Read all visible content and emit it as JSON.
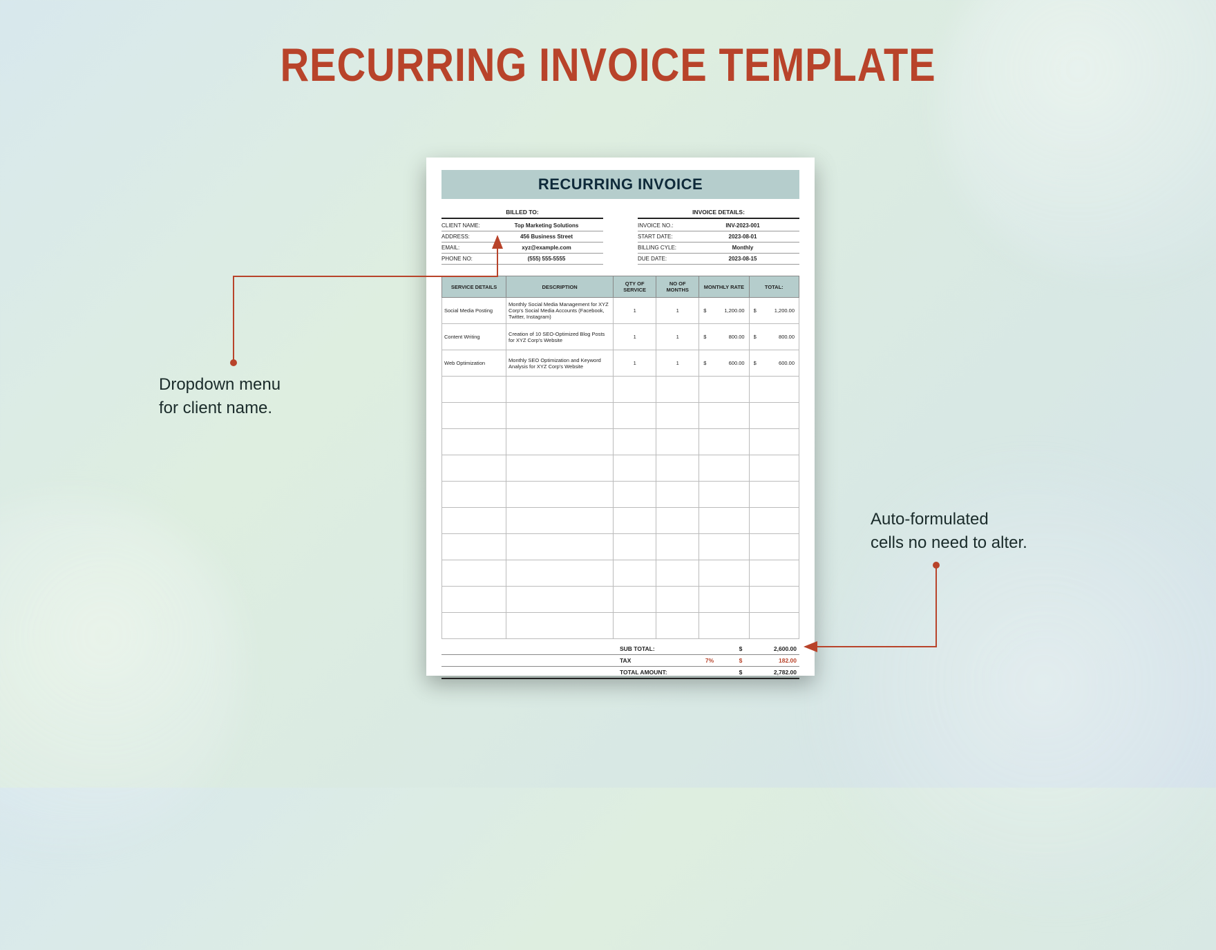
{
  "page_title": "RECURRING INVOICE TEMPLATE",
  "invoice": {
    "header": "RECURRING INVOICE",
    "billed_to_heading": "BILLED TO:",
    "invoice_details_heading": "INVOICE DETAILS:",
    "billed_to": {
      "client_label": "CLIENT NAME:",
      "client_value": "Top Marketing Solutions",
      "address_label": "ADDRESS:",
      "address_value": "456 Business Street",
      "email_label": "EMAIL:",
      "email_value": "xyz@example.com",
      "phone_label": "PHONE NO:",
      "phone_value": "(555) 555-5555"
    },
    "details": {
      "invno_label": "INVOICE NO.:",
      "invno_value": "INV-2023-001",
      "start_label": "START DATE:",
      "start_value": "2023-08-01",
      "cycle_label": "BILLING CYLE:",
      "cycle_value": "Monthly",
      "due_label": "DUE DATE:",
      "due_value": "2023-08-15"
    },
    "columns": {
      "service": "SERVICE DETAILS",
      "description": "DESCRIPTION",
      "qty": "QTY OF SERVICE",
      "months": "NO OF MONTHS",
      "rate": "MONTHLY RATE",
      "total": "TOTAL:"
    },
    "rows": [
      {
        "service": "Social Media Posting",
        "description": "Monthly Social Media Management for XYZ Corp's Social Media Accounts (Facebook, Twitter, Instagram)",
        "qty": "1",
        "months": "1",
        "rate": "1,200.00",
        "total": "1,200.00"
      },
      {
        "service": "Content Writing",
        "description": "Creation of 10 SEO-Optimized Blog Posts for XYZ Corp's Website",
        "qty": "1",
        "months": "1",
        "rate": "800.00",
        "total": "800.00"
      },
      {
        "service": "Web Optimization",
        "description": "Monthly SEO Optimization and Keyword Analysis for XYZ Corp's Website",
        "qty": "1",
        "months": "1",
        "rate": "600.00",
        "total": "600.00"
      }
    ],
    "empty_rows": 10,
    "totals": {
      "subtotal_label": "SUB TOTAL:",
      "subtotal": "2,600.00",
      "tax_label": "TAX",
      "tax_pct": "7%",
      "tax_amount": "182.00",
      "total_label": "TOTAL AMOUNT:",
      "total": "2,782.00",
      "currency": "$"
    }
  },
  "callouts": {
    "left": "Dropdown menu\nfor client name.",
    "right": "Auto-formulated\ncells no need to alter."
  }
}
